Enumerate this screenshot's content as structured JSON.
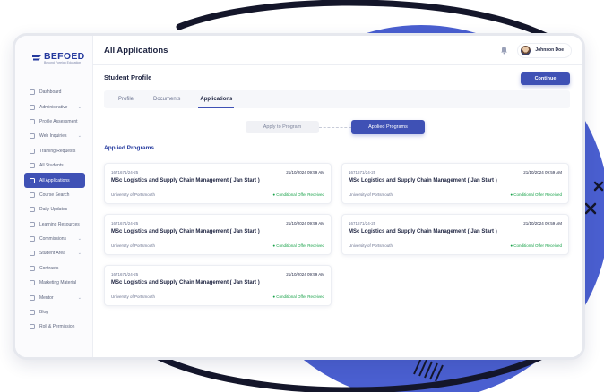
{
  "brand": {
    "name": "BEFOED",
    "tagline": "Beyond Foreign Education"
  },
  "header": {
    "title": "All Applications",
    "user_name": "Johnson Doe"
  },
  "sidebar": {
    "items": [
      {
        "label": "Dashboard",
        "icon": "dashboard-icon",
        "has_chevron": false,
        "active": false
      },
      {
        "label": "Administrative",
        "icon": "admin-icon",
        "has_chevron": true,
        "active": false
      },
      {
        "label": "Profile Assessment",
        "icon": "profile-icon",
        "has_chevron": false,
        "active": false
      },
      {
        "label": "Web Inquiries",
        "icon": "web-icon",
        "has_chevron": true,
        "active": false
      },
      {
        "label": "Training Requests",
        "icon": "training-icon",
        "has_chevron": false,
        "active": false
      },
      {
        "label": "All Students",
        "icon": "students-icon",
        "has_chevron": false,
        "active": false
      },
      {
        "label": "All Applications",
        "icon": "applications-icon",
        "has_chevron": false,
        "active": true
      },
      {
        "label": "Course Search",
        "icon": "search-icon",
        "has_chevron": false,
        "active": false
      },
      {
        "label": "Daily Updates",
        "icon": "updates-icon",
        "has_chevron": false,
        "active": false
      },
      {
        "label": "Learning Resources",
        "icon": "resources-icon",
        "has_chevron": false,
        "active": false
      },
      {
        "label": "Commissions",
        "icon": "commission-icon",
        "has_chevron": true,
        "active": false
      },
      {
        "label": "Student Area",
        "icon": "student-area-icon",
        "has_chevron": true,
        "active": false
      },
      {
        "label": "Contracts",
        "icon": "contracts-icon",
        "has_chevron": false,
        "active": false
      },
      {
        "label": "Marketing Material",
        "icon": "marketing-icon",
        "has_chevron": false,
        "active": false
      },
      {
        "label": "Mentor",
        "icon": "mentor-icon",
        "has_chevron": true,
        "active": false
      },
      {
        "label": "Blog",
        "icon": "blog-icon",
        "has_chevron": false,
        "active": false
      },
      {
        "label": "Roll & Permission",
        "icon": "permission-icon",
        "has_chevron": false,
        "active": false
      }
    ]
  },
  "profile": {
    "title": "Student Profile",
    "continue_label": "Continue",
    "tabs": [
      {
        "label": "Profile",
        "active": false
      },
      {
        "label": "Documents",
        "active": false
      },
      {
        "label": "Applications",
        "active": true
      }
    ],
    "apply_label": "Apply to Program",
    "applied_label": "Applied Programs",
    "section_title": "Applied Programs"
  },
  "applications": [
    {
      "id": "1671671/24-25",
      "date": "21/10/2024 09:59 AM",
      "course": "MSc Logistics and Supply Chain Management ( Jan Start )",
      "university": "University of Portsmouth",
      "status": "Conditional Offer Received"
    },
    {
      "id": "1671671/24-25",
      "date": "21/10/2024 09:59 AM",
      "course": "MSc Logistics and Supply Chain Management ( Jan Start )",
      "university": "University of Portsmouth",
      "status": "Conditional Offer Received"
    },
    {
      "id": "1671671/24-25",
      "date": "21/10/2024 09:59 AM",
      "course": "MSc Logistics and Supply Chain Management ( Jan Start )",
      "university": "University of Portsmouth",
      "status": "Conditional Offer Received"
    },
    {
      "id": "1671671/24-25",
      "date": "21/10/2024 09:59 AM",
      "course": "MSc Logistics and Supply Chain Management ( Jan Start )",
      "university": "University of Portsmouth",
      "status": "Conditional Offer Received"
    },
    {
      "id": "1671671/24-25",
      "date": "21/10/2024 09:59 AM",
      "course": "MSc Logistics and Supply Chain Management ( Jan Start )",
      "university": "University of Portsmouth",
      "status": "Conditional Offer Received"
    }
  ],
  "colors": {
    "accent": "#3f51b5",
    "status_green": "#19a24a",
    "brand_navy": "#253a9e"
  }
}
